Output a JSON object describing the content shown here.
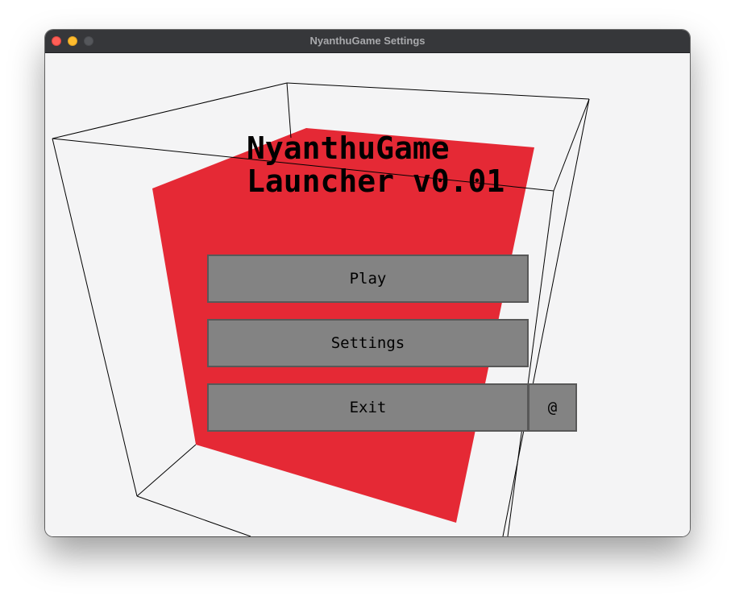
{
  "window": {
    "title": "NyanthuGame Settings"
  },
  "launcher": {
    "heading_line1": "NyanthuGame",
    "heading_line2": "Launcher v0.01",
    "buttons": {
      "play": "Play",
      "settings": "Settings",
      "exit": "Exit",
      "at": "@"
    }
  },
  "colors": {
    "cube_face": "#e52935",
    "background": "#f4f4f5",
    "button_fill": "#838383",
    "button_border": "#585858",
    "titlebar": "#36373a"
  }
}
